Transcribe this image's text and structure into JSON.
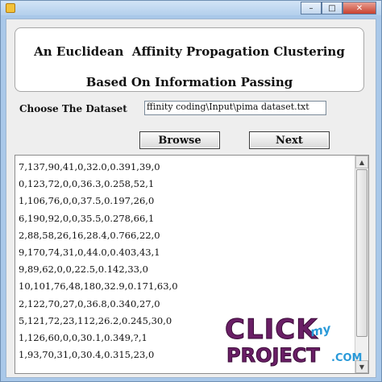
{
  "window": {
    "minimize_glyph": "–",
    "maximize_glyph": "□",
    "close_glyph": "✕"
  },
  "header": {
    "title_line1": "An Euclidean  Affinity Propagation Clustering",
    "title_line2": "Based On Information Passing"
  },
  "dataset": {
    "label": "Choose The Dataset",
    "path_value": "ffinity coding\\Input\\pima dataset.txt"
  },
  "buttons": {
    "browse_label": "Browse",
    "next_label": "Next"
  },
  "data_lines": [
    "7,137,90,41,0,32.0,0.391,39,0",
    "0,123,72,0,0,36.3,0.258,52,1",
    "1,106,76,0,0,37.5,0.197,26,0",
    "6,190,92,0,0,35.5,0.278,66,1",
    "2,88,58,26,16,28.4,0.766,22,0",
    "9,170,74,31,0,44.0,0.403,43,1",
    "9,89,62,0,0,22.5,0.142,33,0",
    "10,101,76,48,180,32.9,0.171,63,0",
    "2,122,70,27,0,36.8,0.340,27,0",
    "5,121,72,23,112,26.2,0.245,30,0",
    "1,126,60,0,0,30.1,0.349,?,1",
    "1,93,70,31,0,30.4,0.315,23,0"
  ],
  "scrollbar": {
    "up_glyph": "▲",
    "down_glyph": "▼"
  },
  "watermark": {
    "click": "CLICK",
    "my": "my",
    "project": "PROJECT",
    "com": ".COM"
  },
  "colors": {
    "window_frame": "#a9c8e9",
    "close_button": "#c8412e",
    "panel_background": "#eeeeee",
    "watermark_purple": "#6a1f66",
    "watermark_blue": "#2a9ad9"
  }
}
